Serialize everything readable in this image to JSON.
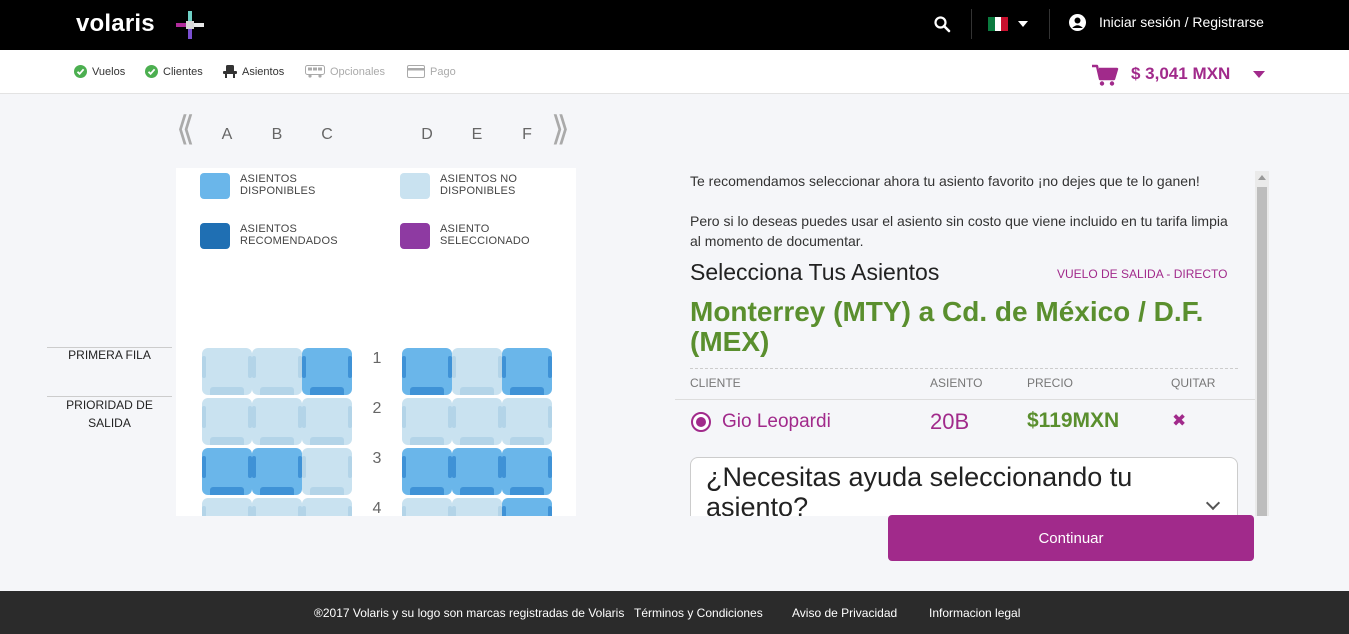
{
  "header": {
    "logo_text": "volaris",
    "login_label": "Iniciar sesión / Registrarse"
  },
  "steps": [
    {
      "label": "Vuelos",
      "state": "done"
    },
    {
      "label": "Clientes",
      "state": "done"
    },
    {
      "label": "Asientos",
      "state": "current"
    },
    {
      "label": "Opcionales",
      "state": "disabled"
    },
    {
      "label": "Pago",
      "state": "disabled"
    }
  ],
  "cart": {
    "total": "$ 3,041 MXN"
  },
  "seatmap": {
    "columns": [
      "A",
      "B",
      "C",
      "D",
      "E",
      "F"
    ],
    "legend": {
      "available": "ASIENTOS DISPONIBLES",
      "not_available": "ASIENTOS NO DISPONIBLES",
      "recommended": "ASIENTOS RECOMENDADOS",
      "selected": "ASIENTO SELECCIONADO"
    },
    "rows": [
      {
        "number": "1",
        "seats": [
          "na",
          "na",
          "av",
          "av",
          "na",
          "av"
        ]
      },
      {
        "number": "2",
        "seats": [
          "na",
          "na",
          "na",
          "na",
          "na",
          "na"
        ]
      },
      {
        "number": "3",
        "seats": [
          "av",
          "av",
          "na",
          "av",
          "av",
          "av"
        ]
      },
      {
        "number": "4",
        "seats": [
          "na",
          "na",
          "na",
          "na",
          "na",
          "av"
        ]
      }
    ],
    "side_labels": {
      "first_row": "PRIMERA FILA",
      "priority": "PRIORIDAD DE SALIDA"
    }
  },
  "info": {
    "recommend_text": "Te recomendamos seleccionar ahora tu asiento favorito ¡no dejes que te lo ganen!",
    "free_seat_text": "Pero si lo deseas puedes usar el asiento sin costo que viene incluido en tu tarifa limpia al momento de documentar.",
    "select_title": "Selecciona Tus Asientos",
    "flight_type": "VUELO DE SALIDA - DIRECTO",
    "route": "Monterrey (MTY) a Cd. de México / D.F. (MEX)",
    "table_headers": {
      "client": "CLIENTE",
      "seat": "ASIENTO",
      "price": "PRECIO",
      "remove": "QUITAR"
    },
    "passenger": {
      "name": "Gio Leopardi",
      "seat": "20B",
      "price": "$119MXN"
    },
    "help_title": "¿Necesitas ayuda seleccionando tu asiento?"
  },
  "continue_label": "Continuar",
  "footer": {
    "copyright": "®2017 Volaris y su logo son marcas registradas de Volaris",
    "terms": "Términos y Condiciones",
    "privacy": "Aviso de Privacidad",
    "legal": "Informacion legal"
  },
  "colors": {
    "brand_purple": "#a12a8b",
    "route_green": "#5a8f2e",
    "seat_available": "#6ab6ea",
    "seat_not_available": "#c9e2f0",
    "seat_recommended": "#1f6fb3",
    "seat_selected": "#8e3aa2"
  },
  "icons": [
    "search-icon",
    "flag-mexico-icon",
    "user-icon",
    "check-icon",
    "seat-icon",
    "bus-icon",
    "card-icon",
    "cart-icon",
    "remove-icon",
    "chevron-left-icon",
    "chevron-right-icon",
    "chevron-down-icon"
  ]
}
